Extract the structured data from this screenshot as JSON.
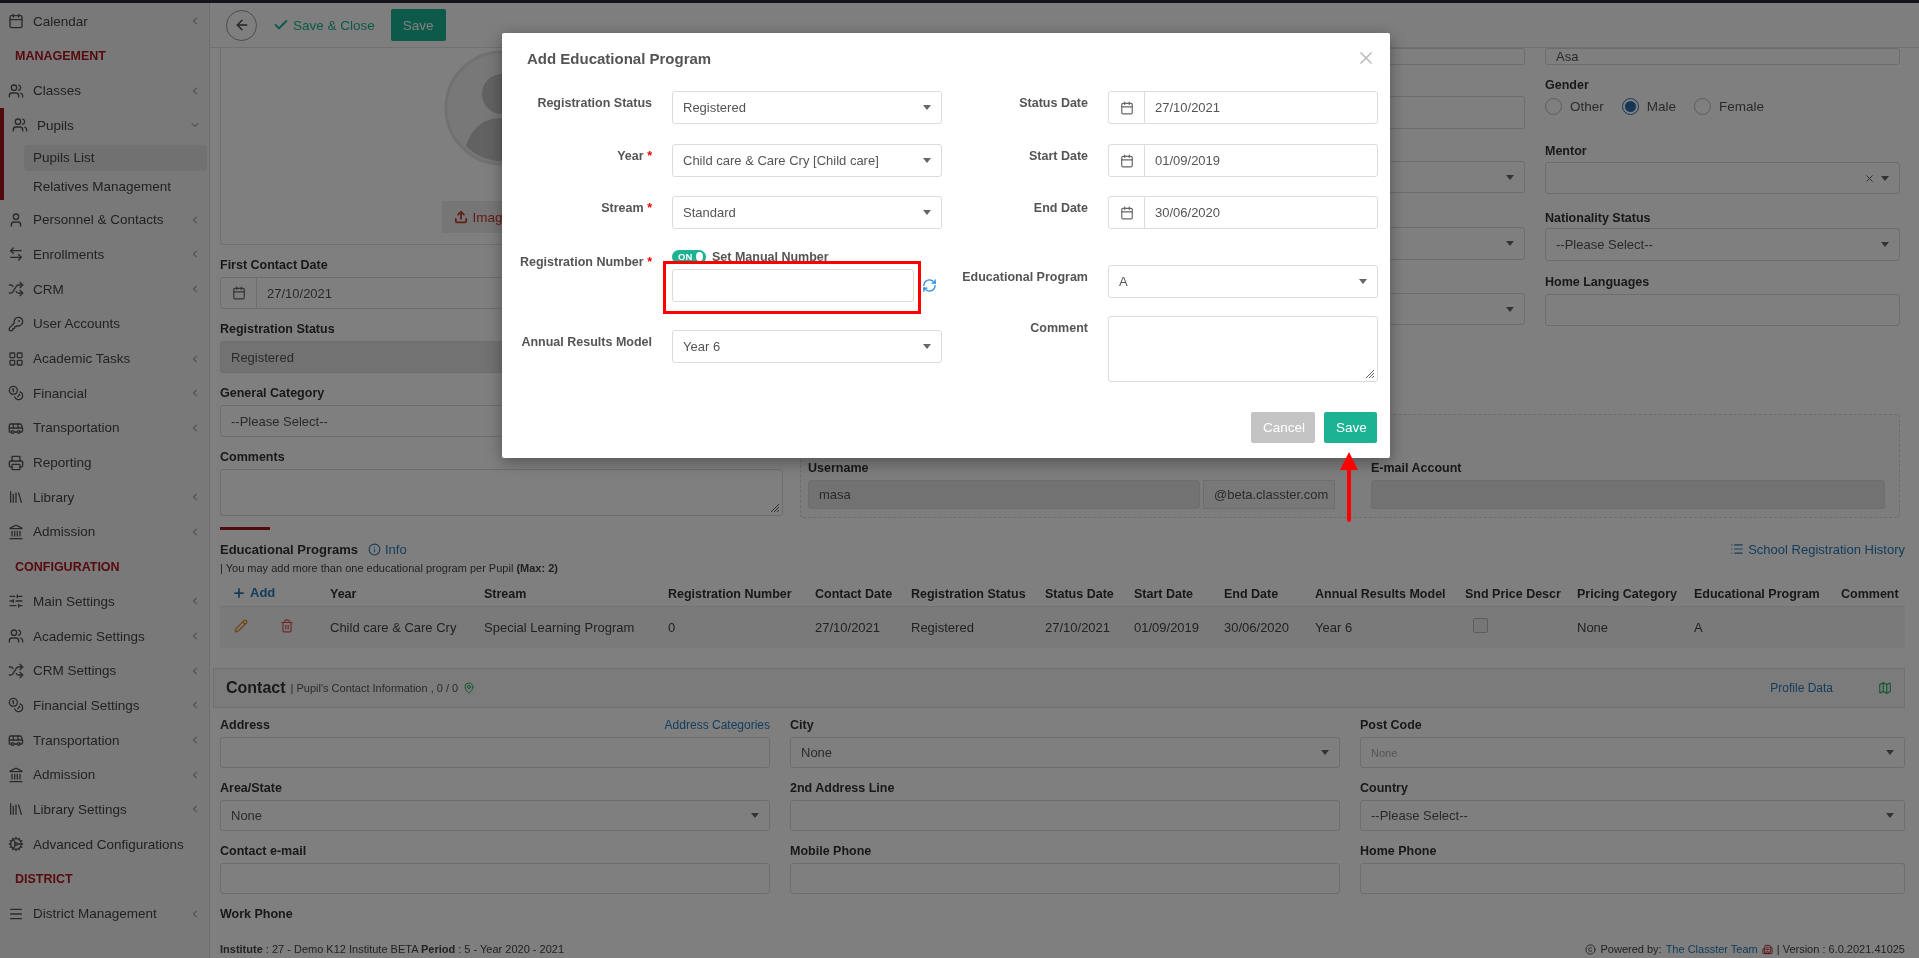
{
  "topbar": {
    "save_close": "Save & Close",
    "save": "Save"
  },
  "sidebar": {
    "items": [
      {
        "kind": "item",
        "label": "Calendar",
        "expanded": false,
        "selected": false
      },
      {
        "kind": "heading",
        "label": "MANAGEMENT"
      },
      {
        "kind": "item",
        "label": "Classes",
        "expanded": false,
        "selected": false
      },
      {
        "kind": "item",
        "label": "Pupils",
        "expanded": true,
        "selected": true,
        "children": [
          {
            "label": "Pupils List",
            "selected": true
          },
          {
            "label": "Relatives Management",
            "selected": false
          }
        ]
      },
      {
        "kind": "item",
        "label": "Personnel & Contacts",
        "expanded": false,
        "selected": false
      },
      {
        "kind": "item",
        "label": "Enrollments",
        "expanded": false,
        "selected": false
      },
      {
        "kind": "item",
        "label": "CRM",
        "expanded": false,
        "selected": false
      },
      {
        "kind": "item",
        "label": "User Accounts",
        "selected": false
      },
      {
        "kind": "item",
        "label": "Academic Tasks",
        "expanded": false,
        "selected": false
      },
      {
        "kind": "item",
        "label": "Financial",
        "expanded": false,
        "selected": false
      },
      {
        "kind": "item",
        "label": "Transportation",
        "expanded": false,
        "selected": false
      },
      {
        "kind": "item",
        "label": "Reporting",
        "selected": false
      },
      {
        "kind": "item",
        "label": "Library",
        "expanded": false,
        "selected": false
      },
      {
        "kind": "item",
        "label": "Admission",
        "expanded": false,
        "selected": false
      },
      {
        "kind": "heading",
        "label": "CONFIGURATION"
      },
      {
        "kind": "item",
        "label": "Main Settings",
        "expanded": false,
        "selected": false
      },
      {
        "kind": "item",
        "label": "Academic Settings",
        "expanded": false,
        "selected": false
      },
      {
        "kind": "item",
        "label": "CRM Settings",
        "expanded": false,
        "selected": false
      },
      {
        "kind": "item",
        "label": "Financial Settings",
        "expanded": false,
        "selected": false
      },
      {
        "kind": "item",
        "label": "Transportation",
        "expanded": false,
        "selected": false
      },
      {
        "kind": "item",
        "label": "Admission",
        "expanded": false,
        "selected": false
      },
      {
        "kind": "item",
        "label": "Library Settings",
        "expanded": false,
        "selected": false
      },
      {
        "kind": "item",
        "label": "Advanced Configurations",
        "selected": false
      },
      {
        "kind": "heading",
        "label": "DISTRICT"
      },
      {
        "kind": "item",
        "label": "District Management",
        "expanded": false,
        "selected": false
      }
    ]
  },
  "left_column": {
    "upload_label": "Imag",
    "fields": [
      {
        "label": "First Contact Date",
        "kind": "date",
        "value": "27/10/2021",
        "disabled": false
      },
      {
        "label": "Registration Status",
        "kind": "text",
        "value": "Registered",
        "disabled": true
      },
      {
        "label": "General Category",
        "kind": "text",
        "value": "--Please Select--",
        "disabled": false
      },
      {
        "label": "Comments",
        "kind": "textarea",
        "disabled": false
      }
    ]
  },
  "middle_fields": [
    {
      "kind": "text"
    },
    {
      "kind": "text"
    },
    {
      "kind": "select"
    },
    {
      "kind": "select"
    },
    {
      "kind": "select"
    }
  ],
  "right_column": {
    "name_value": "Asa",
    "gender": {
      "label": "Gender",
      "options": [
        {
          "label": "Other",
          "selected": false
        },
        {
          "label": "Male",
          "selected": true
        },
        {
          "label": "Female",
          "selected": false
        }
      ]
    },
    "mentor_label": "Mentor",
    "nationality": {
      "label": "Nationality Status",
      "value": "--Please Select--"
    },
    "languages_label": "Home Languages"
  },
  "account": {
    "username_label": "Username",
    "username": "masa",
    "domain": "@beta.classter.com",
    "email_label": "E-mail Account"
  },
  "programs": {
    "title": "Educational Programs",
    "info": "Info",
    "history": "School Registration History",
    "note": "| You may add more than one educational program per Pupil **(Max: 2)**",
    "add": "Add",
    "columns": [
      {
        "label": "Year",
        "kind": "text"
      },
      {
        "label": "Stream",
        "kind": "text"
      },
      {
        "label": "Registration Number",
        "kind": "text"
      },
      {
        "label": "Contact Date",
        "kind": "text"
      },
      {
        "label": "Registration Status",
        "kind": "text"
      },
      {
        "label": "Status Date",
        "kind": "text"
      },
      {
        "label": "Start Date",
        "kind": "text"
      },
      {
        "label": "End Date",
        "kind": "text"
      },
      {
        "label": "Annual Results Model",
        "kind": "text"
      },
      {
        "label": "Snd Price Descr",
        "kind": "checkbox"
      },
      {
        "label": "Pricing Category",
        "kind": "text"
      },
      {
        "label": "Educational Program",
        "kind": "text"
      },
      {
        "label": "Comment",
        "kind": "text"
      }
    ],
    "rows": [
      {
        "cells": [
          "Child care & Care Cry",
          "Special Learning Program",
          "0",
          "27/10/2021",
          "Registered",
          "27/10/2021",
          "01/09/2019",
          "30/06/2020",
          "Year 6",
          "",
          "None",
          "A"
        ],
        "checks": [
          false
        ]
      }
    ]
  },
  "contact": {
    "title": "Contact",
    "subtitle": "| Pupil's Contact Information , 0 / 0",
    "profile_link": "Profile Data",
    "fields": [
      {
        "label": "Address",
        "kind": "text",
        "link": "Address Categories"
      },
      {
        "label": "City",
        "kind": "select",
        "value": "None"
      },
      {
        "label": "Post Code",
        "kind": "select",
        "placeholder": "None"
      },
      {
        "label": "Area/State",
        "kind": "select",
        "value": "None"
      },
      {
        "label": "2nd Address Line",
        "kind": "text"
      },
      {
        "label": "Country",
        "kind": "select",
        "value": "--Please Select--"
      },
      {
        "label": "Contact e-mail",
        "kind": "text"
      },
      {
        "label": "Mobile Phone",
        "kind": "text"
      },
      {
        "label": "Home Phone",
        "kind": "text"
      },
      {
        "label": "Work Phone",
        "kind": "label"
      }
    ]
  },
  "footer": {
    "info": "**Institute** : 27 - Demo K12 Institute BETA **Period** : 5 - Year 2020 - 2021",
    "powered_by": "Powered by:",
    "team_link": "The Classter Team",
    "version": "| Version : 6.0.2021.41025"
  },
  "modal": {
    "title": "Add Educational Program",
    "left_fields": [
      {
        "label": "Registration Status",
        "kind": "select",
        "value": "Registered"
      },
      {
        "label": "Year",
        "mark": "*",
        "kind": "select",
        "value": "Child care & Care Cry [Child care]"
      },
      {
        "label": "Stream",
        "mark": "*",
        "kind": "select",
        "value": "Standard"
      },
      {
        "label": "Registration Number",
        "mark": "*",
        "kind": "number",
        "toggle": {
          "text": "ON",
          "on": true,
          "label": "Set Manual Number"
        }
      },
      {
        "label": "Annual Results Model",
        "kind": "select",
        "value": "Year 6"
      }
    ],
    "right_fields": [
      {
        "label": "Status Date",
        "kind": "date",
        "value": "27/10/2021"
      },
      {
        "label": "Start Date",
        "kind": "date",
        "value": "01/09/2019"
      },
      {
        "label": "End Date",
        "kind": "date",
        "value": "30/06/2020"
      },
      {
        "label": "Educational Program",
        "kind": "select",
        "value": "A"
      },
      {
        "label": "Comment",
        "kind": "textarea"
      }
    ],
    "buttons": [
      {
        "label": "Cancel",
        "kind": "cancel"
      },
      {
        "label": "Save",
        "kind": "primary"
      }
    ]
  }
}
